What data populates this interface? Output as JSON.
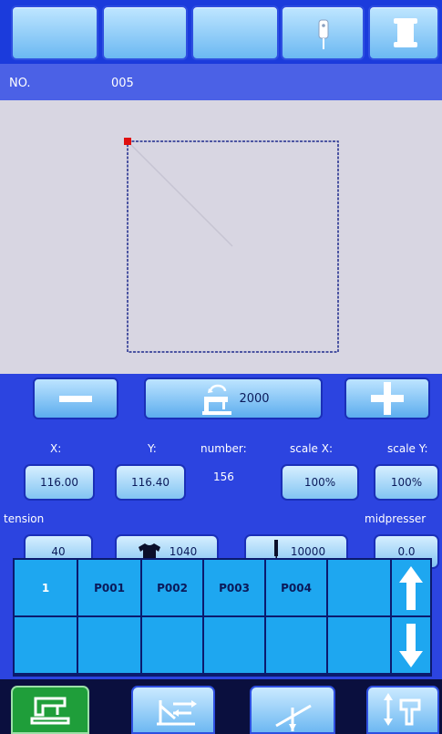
{
  "toolbar": {
    "buttons": [
      {
        "icon": ""
      },
      {
        "icon": ""
      },
      {
        "icon": ""
      },
      {
        "icon": "needle-icon"
      },
      {
        "icon": "bobbin-icon"
      }
    ]
  },
  "info": {
    "no_label": "NO.",
    "no_value": "005"
  },
  "controls": {
    "speed_value": "2000",
    "x_label": "X:",
    "y_label": "Y:",
    "number_label": "number:",
    "scalex_label": "scale X:",
    "scaley_label": "scale Y:",
    "x_value": "116.00",
    "y_value": "116.40",
    "number_value": "156",
    "scalex_value": "100%",
    "scaley_value": "100%",
    "tension_label": "tension",
    "midpresser_label": "midpresser",
    "tension_value": "40",
    "shirt_value": "1040",
    "needle_value": "10000",
    "midpresser_value": "0.0"
  },
  "programs": {
    "row1": [
      "1",
      "P001",
      "P002",
      "P003",
      "P004",
      "",
      ""
    ],
    "row2": [
      "",
      "",
      "",
      "",
      "",
      "",
      ""
    ]
  },
  "colors": {
    "accent": "#2c44e0",
    "button": "#82c4f2",
    "start_marker": "#e01010",
    "active_tab": "#1f9e3a"
  }
}
